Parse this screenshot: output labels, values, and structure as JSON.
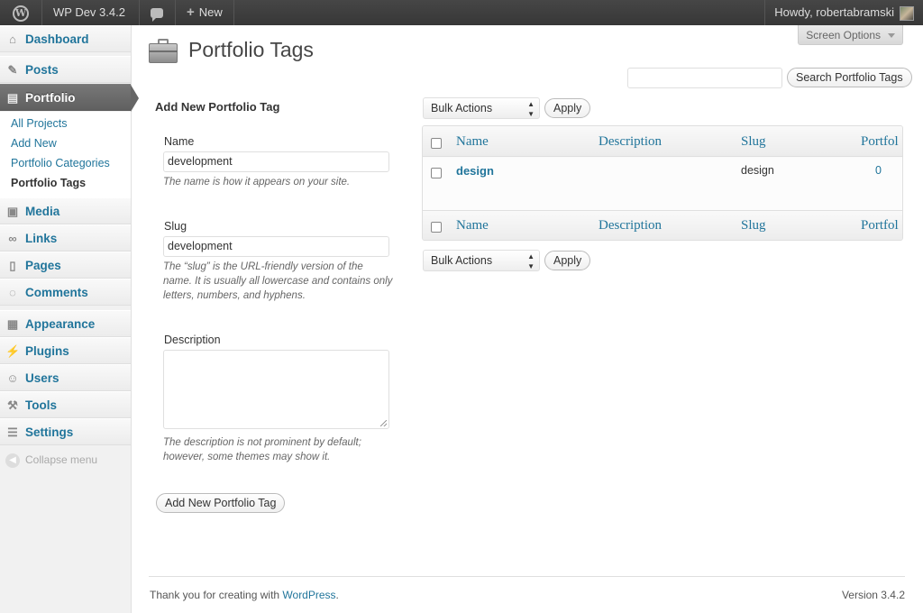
{
  "adminbar": {
    "site_name": "WP Dev 3.4.2",
    "new_label": "New",
    "howdy": "Howdy, robertabramski"
  },
  "sidebar": {
    "items": [
      {
        "label": "Dashboard",
        "icon": "dashboard-icon"
      },
      {
        "label": "Posts",
        "icon": "pushpin-icon"
      },
      {
        "label": "Portfolio",
        "icon": "briefcase-icon"
      },
      {
        "label": "Media",
        "icon": "media-icon"
      },
      {
        "label": "Links",
        "icon": "link-icon"
      },
      {
        "label": "Pages",
        "icon": "pages-icon"
      },
      {
        "label": "Comments",
        "icon": "comment-icon"
      },
      {
        "label": "Appearance",
        "icon": "appearance-icon"
      },
      {
        "label": "Plugins",
        "icon": "plugin-icon"
      },
      {
        "label": "Users",
        "icon": "users-icon"
      },
      {
        "label": "Tools",
        "icon": "tools-icon"
      },
      {
        "label": "Settings",
        "icon": "settings-icon"
      }
    ],
    "submenu": [
      "All Projects",
      "Add New",
      "Portfolio Categories",
      "Portfolio Tags"
    ],
    "collapse_label": "Collapse menu"
  },
  "screen_options": "Screen Options",
  "page_title": "Portfolio Tags",
  "search": {
    "value": "",
    "button": "Search Portfolio Tags"
  },
  "form": {
    "title": "Add New Portfolio Tag",
    "name_label": "Name",
    "name_value": "development",
    "name_help": "The name is how it appears on your site.",
    "slug_label": "Slug",
    "slug_value": "development",
    "slug_help": "The “slug” is the URL-friendly version of the name. It is usually all lowercase and contains only letters, numbers, and hyphens.",
    "description_label": "Description",
    "description_help": "The description is not prominent by default; however, some themes may show it.",
    "submit": "Add New Portfolio Tag"
  },
  "table": {
    "bulk_actions": "Bulk Actions",
    "apply": "Apply",
    "columns": [
      "Name",
      "Description",
      "Slug",
      "Portfol"
    ],
    "rows": [
      {
        "name": "design",
        "description": "",
        "slug": "design",
        "count": "0"
      }
    ]
  },
  "footer": {
    "thanks_prefix": "Thank you for creating with ",
    "wordpress_link": "WordPress",
    "thanks_suffix": ".",
    "version": "Version 3.4.2"
  },
  "colors": {
    "link": "#21759b",
    "adminbar": "#464646",
    "current_menu": "#6d6d6d"
  }
}
